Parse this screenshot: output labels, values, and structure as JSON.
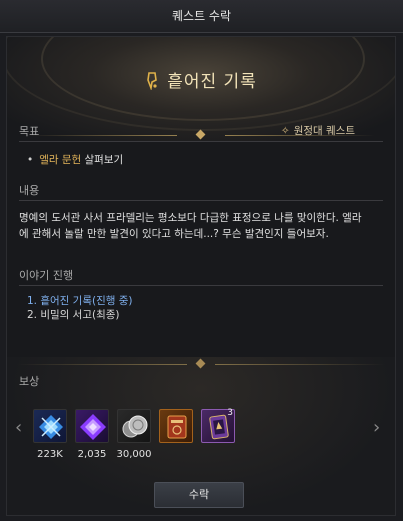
{
  "window": {
    "title": "퀘스트 수락"
  },
  "quest": {
    "title": "흩어진 기록",
    "type": "원정대 퀘스트"
  },
  "sections": {
    "objective_label": "목표",
    "content_label": "내용",
    "story_label": "이야기 진행",
    "rewards_label": "보상"
  },
  "objective": {
    "highlight": "엘라 문헌",
    "rest": " 살펴보기"
  },
  "content": "명예의 도서관 사서 프라델리는 평소보다 다급한 표정으로 나를 맞이한다. 엘라에 관해서 놀랄 만한 발견이 있다고 하는데...? 무슨 발견인지 들어보자.",
  "story": [
    "1. 흩어진 기록(진행 중)",
    "2. 비밀의 서고(최종)"
  ],
  "rewards": [
    {
      "icon": "blue-crystal-icon",
      "amount": "223K"
    },
    {
      "icon": "purple-gem-icon",
      "amount": "2,035"
    },
    {
      "icon": "silver-coins-icon",
      "amount": "30,000"
    },
    {
      "icon": "red-book-icon",
      "amount": ""
    },
    {
      "icon": "purple-card-icon",
      "amount": "",
      "badge": "3"
    }
  ],
  "buttons": {
    "accept": "수락"
  },
  "colors": {
    "title_gold": "#f2e3b8",
    "objective_highlight": "#e3b55a",
    "story_current": "#7fb0ee"
  }
}
